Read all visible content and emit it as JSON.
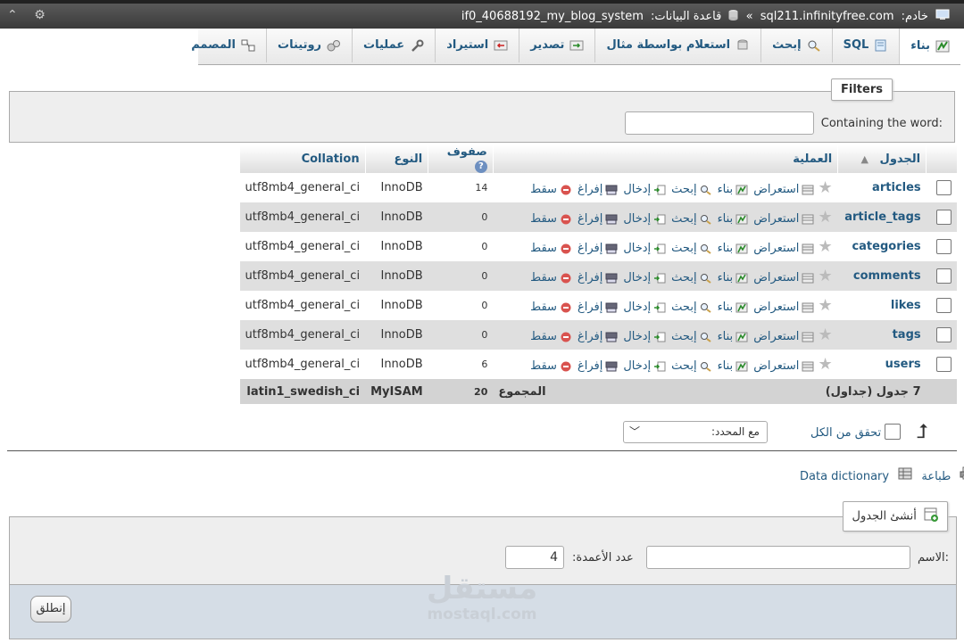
{
  "breadcrumb": {
    "server_label": "خادم:",
    "server": "sql211.infinityfree.com",
    "sep": "»",
    "db_label": "قاعدة البيانات:",
    "database": "if0_40688192_my_blog_system"
  },
  "tabs": [
    {
      "label": "بناء",
      "icon": "structure-icon",
      "active": true
    },
    {
      "label": "SQL",
      "icon": "sql-icon"
    },
    {
      "label": "إبحث",
      "icon": "search-icon"
    },
    {
      "label": "استعلام بواسطة مثال",
      "icon": "query-icon"
    },
    {
      "label": "تصدير",
      "icon": "export-icon"
    },
    {
      "label": "استيراد",
      "icon": "import-icon"
    },
    {
      "label": "عمليات",
      "icon": "operations-icon"
    },
    {
      "label": "روتينات",
      "icon": "routines-icon"
    },
    {
      "label": "المصمم",
      "icon": "designer-icon"
    }
  ],
  "filters": {
    "legend": "Filters",
    "label": "Containing the word:",
    "value": ""
  },
  "table": {
    "headers": {
      "table": "الجدول",
      "sort_arrow": "▲",
      "action": "العملية",
      "rows": "صفوف",
      "type": "النوع",
      "collation": "Collation"
    },
    "actions": {
      "browse": "استعراض",
      "structure": "بناء",
      "search": "إبحث",
      "insert": "إدخال",
      "empty": "إفراغ",
      "drop": "سقط"
    },
    "rows": [
      {
        "name": "articles",
        "rows": "14",
        "type": "InnoDB",
        "collation": "utf8mb4_general_ci"
      },
      {
        "name": "article_tags",
        "rows": "0",
        "type": "InnoDB",
        "collation": "utf8mb4_general_ci"
      },
      {
        "name": "categories",
        "rows": "0",
        "type": "InnoDB",
        "collation": "utf8mb4_general_ci"
      },
      {
        "name": "comments",
        "rows": "0",
        "type": "InnoDB",
        "collation": "utf8mb4_general_ci"
      },
      {
        "name": "likes",
        "rows": "0",
        "type": "InnoDB",
        "collation": "utf8mb4_general_ci"
      },
      {
        "name": "tags",
        "rows": "0",
        "type": "InnoDB",
        "collation": "utf8mb4_general_ci"
      },
      {
        "name": "users",
        "rows": "6",
        "type": "InnoDB",
        "collation": "utf8mb4_general_ci"
      }
    ],
    "total": {
      "count_label": "7 جدول (جداول)",
      "sum_label": "المجموع",
      "rows": "20",
      "type": "MyISAM",
      "collation": "latin1_swedish_ci"
    }
  },
  "bulk": {
    "check_all": "تحقق من الكل",
    "with_selected": "مع المحدد:"
  },
  "links": {
    "print": "طباعة",
    "data_dictionary": "Data dictionary"
  },
  "create_table": {
    "legend": "أنشئ الجدول",
    "name_label": "الاسم:",
    "name_value": "",
    "columns_label": "عدد الأعمدة:",
    "columns_value": "4",
    "go": "إنطلق"
  },
  "watermark": {
    "arabic": "مستقل",
    "latin": "mostaql.com"
  },
  "colors": {
    "link": "#235a81",
    "even_row": "#dfdfdf",
    "drop_icon": "#d9534f"
  }
}
